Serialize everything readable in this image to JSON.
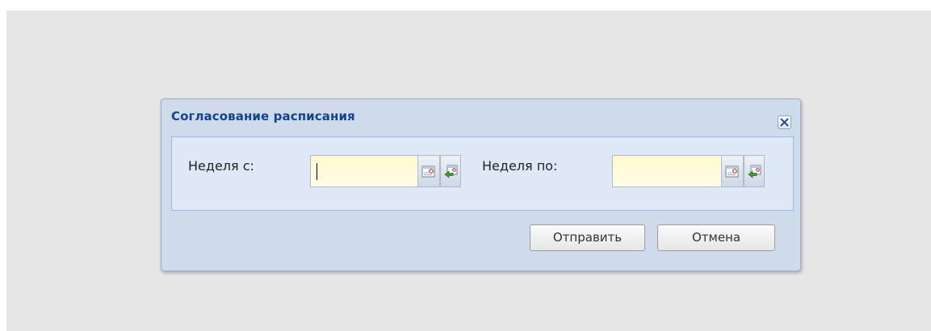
{
  "dialog": {
    "title": "Согласование расписания",
    "close_icon": "close-icon"
  },
  "form": {
    "week_from": {
      "label": "Неделя с:",
      "value": "",
      "calendar_icon": "calendar-icon",
      "apply_icon": "calendar-apply-icon"
    },
    "week_to": {
      "label": "Неделя по:",
      "value": "",
      "calendar_icon": "calendar-icon",
      "apply_icon": "calendar-apply-icon"
    }
  },
  "buttons": {
    "submit_label": "Отправить",
    "cancel_label": "Отмена"
  },
  "colors": {
    "background": "#e6e6e6",
    "dialog_frame": "#cfdaea",
    "title": "#15428b",
    "field_background": "#fffad0"
  }
}
